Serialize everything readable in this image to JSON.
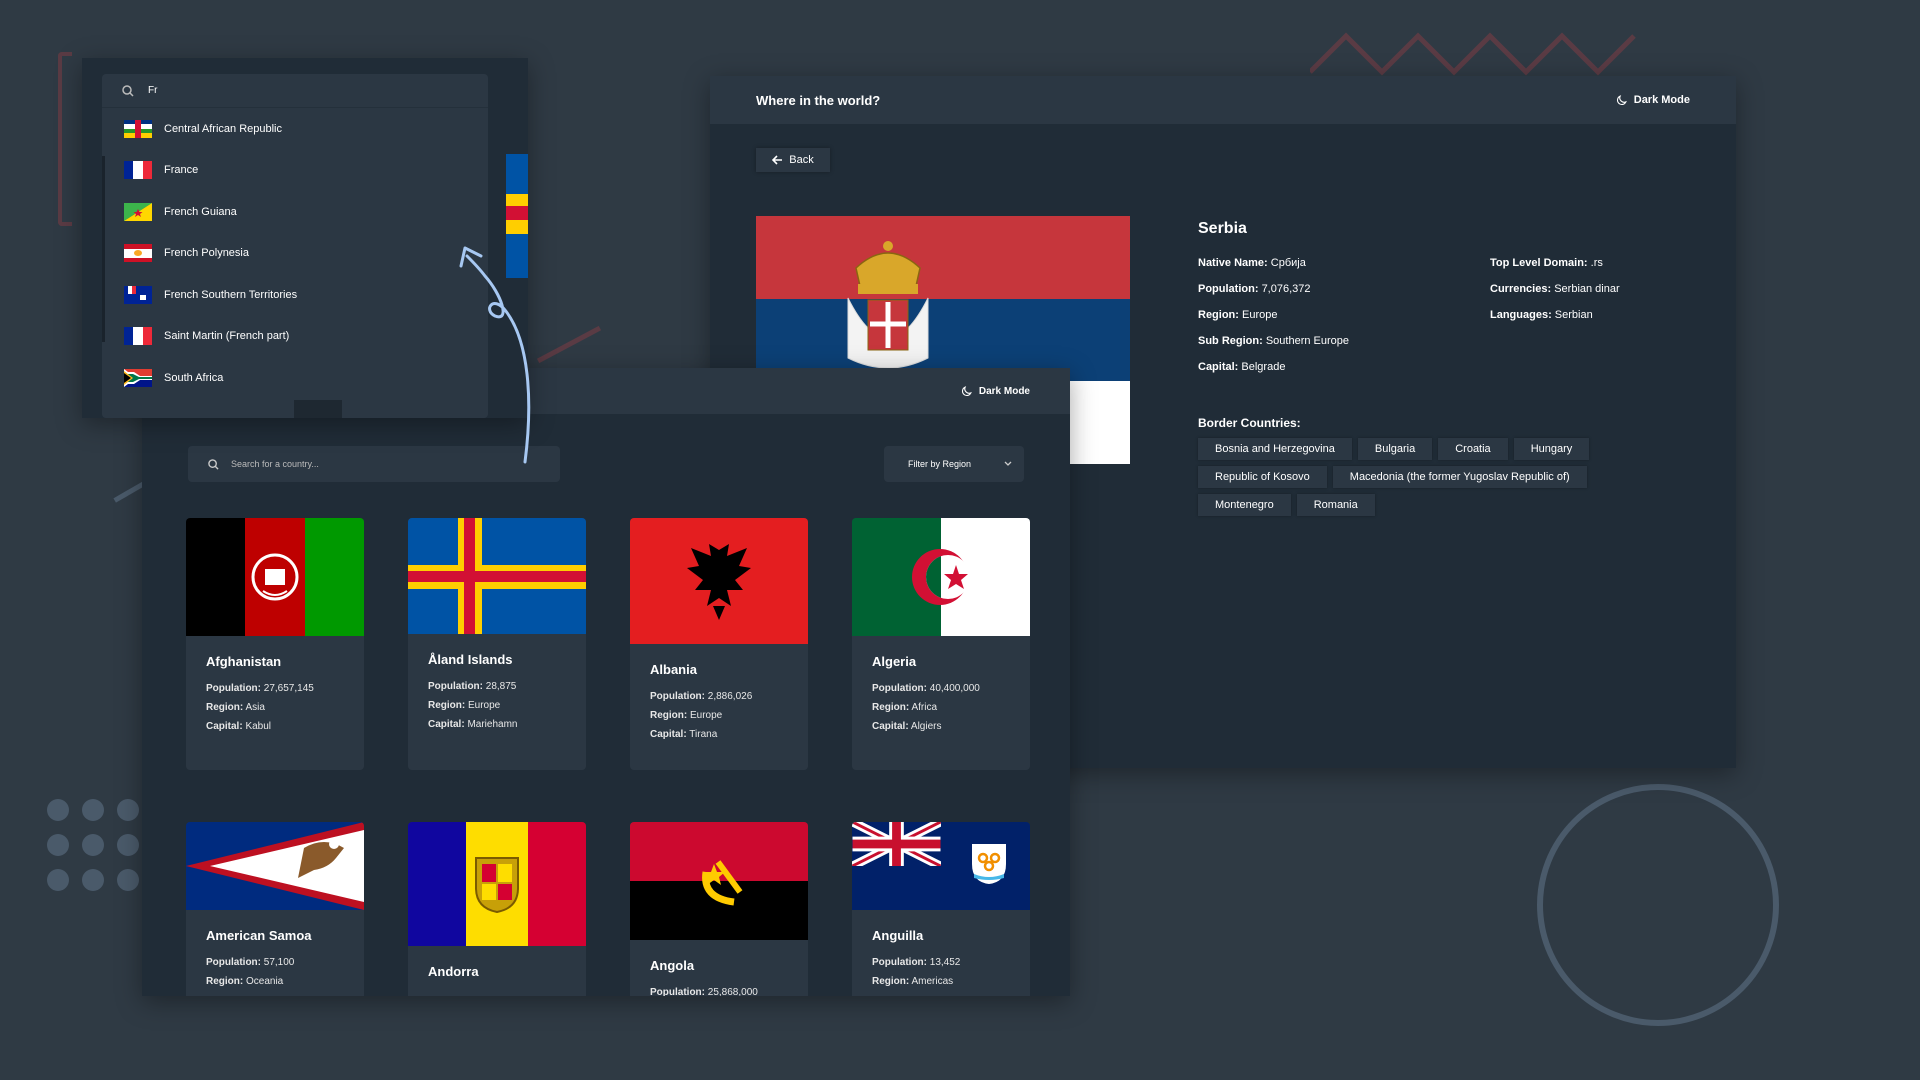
{
  "colors": {
    "background": "#2f3a44",
    "window": "#202c37",
    "element": "#2b3743",
    "accent_arrow": "#a7c8f2",
    "deco_red": "#5a3b44",
    "deco_grey": "#4a5a6a"
  },
  "search_dropdown": {
    "query": "Fr",
    "items": [
      {
        "label": "Central African Republic",
        "flag": "central-african-republic-flag-icon"
      },
      {
        "label": "France",
        "flag": "france-flag-icon"
      },
      {
        "label": "French Guiana",
        "flag": "french-guiana-flag-icon"
      },
      {
        "label": "French Polynesia",
        "flag": "french-polynesia-flag-icon"
      },
      {
        "label": "French Southern Territories",
        "flag": "french-southern-territories-flag-icon"
      },
      {
        "label": "Saint Martin (French part)",
        "flag": "saint-martin-flag-icon"
      },
      {
        "label": "South Africa",
        "flag": "south-africa-flag-icon"
      }
    ]
  },
  "home": {
    "dark_mode_label": "Dark Mode",
    "search_placeholder": "Search for a country...",
    "filter_label": "Filter by Region",
    "cards": [
      {
        "name": "Afghanistan",
        "population": "27,657,145",
        "region": "Asia",
        "capital": "Kabul"
      },
      {
        "name": "Åland Islands",
        "population": "28,875",
        "region": "Europe",
        "capital": "Mariehamn"
      },
      {
        "name": "Albania",
        "population": "2,886,026",
        "region": "Europe",
        "capital": "Tirana"
      },
      {
        "name": "Algeria",
        "population": "40,400,000",
        "region": "Africa",
        "capital": "Algiers"
      },
      {
        "name": "American Samoa",
        "population": "57,100",
        "region": "Oceania"
      },
      {
        "name": "Andorra"
      },
      {
        "name": "Angola",
        "population": "25,868,000"
      },
      {
        "name": "Anguilla",
        "population": "13,452",
        "region": "Americas"
      }
    ],
    "labels": {
      "population": "Population:",
      "region": "Region:",
      "capital": "Capital:"
    }
  },
  "detail": {
    "app_title": "Where in the world?",
    "dark_mode_label": "Dark Mode",
    "back_label": "Back",
    "country": "Serbia",
    "native_name_label": "Native Name:",
    "native_name": "Србија",
    "population_label": "Population:",
    "population": "7,076,372",
    "region_label": "Region:",
    "region": "Europe",
    "sub_region_label": "Sub Region:",
    "sub_region": "Southern Europe",
    "capital_label": "Capital:",
    "capital": "Belgrade",
    "tld_label": "Top Level Domain:",
    "tld": ".rs",
    "currencies_label": "Currencies:",
    "currencies": "Serbian dinar",
    "languages_label": "Languages:",
    "languages": "Serbian",
    "border_label": "Border Countries:",
    "borders": [
      "Bosnia and Herzegovina",
      "Bulgaria",
      "Croatia",
      "Hungary",
      "Republic of Kosovo",
      "Macedonia (the former Yugoslav Republic of)",
      "Montenegro",
      "Romania"
    ]
  }
}
